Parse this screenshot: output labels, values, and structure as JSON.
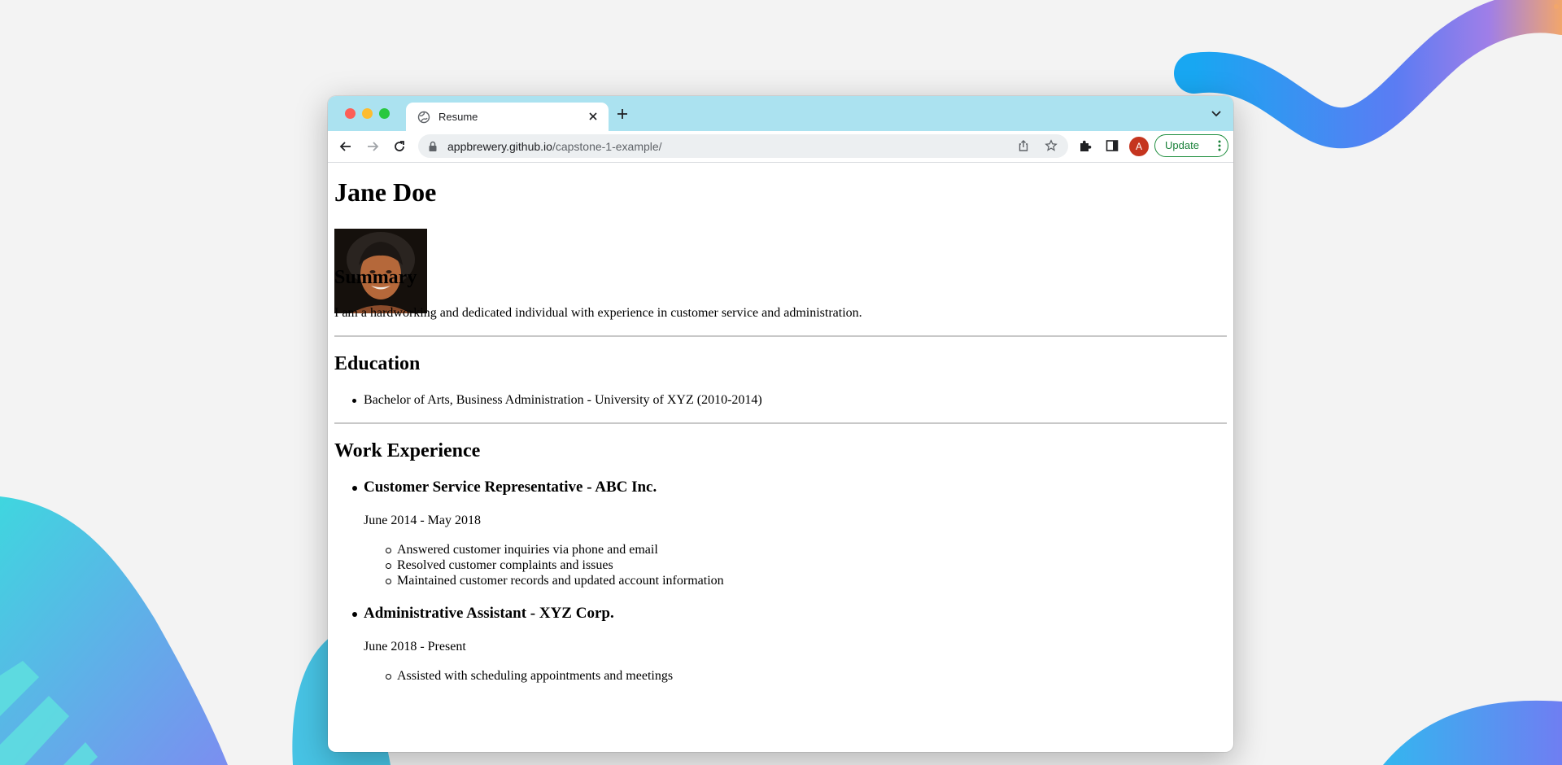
{
  "browser": {
    "tab": {
      "title": "Resume"
    },
    "address": {
      "host": "appbrewery.github.io",
      "path": "/capstone-1-example/"
    },
    "profile_initial": "A",
    "update_label": "Update"
  },
  "resume": {
    "name": "Jane Doe",
    "summary": {
      "heading": "Summary",
      "text": "I am a hardworking and dedicated individual with experience in customer service and administration."
    },
    "education": {
      "heading": "Education",
      "items": [
        "Bachelor of Arts, Business Administration - University of XYZ (2010-2014)"
      ]
    },
    "work": {
      "heading": "Work Experience",
      "jobs": [
        {
          "title": "Customer Service Representative - ABC Inc.",
          "dates": "June 2014 - May 2018",
          "duties": [
            "Answered customer inquiries via phone and email",
            "Resolved customer complaints and issues",
            "Maintained customer records and updated account information"
          ]
        },
        {
          "title": "Administrative Assistant - XYZ Corp.",
          "dates": "June 2018 - Present",
          "duties": [
            "Assisted with scheduling appointments and meetings"
          ]
        }
      ]
    }
  },
  "colors": {
    "tab_strip": "#abe2f0",
    "update_green": "#188038",
    "avatar_red": "#c5351f"
  }
}
